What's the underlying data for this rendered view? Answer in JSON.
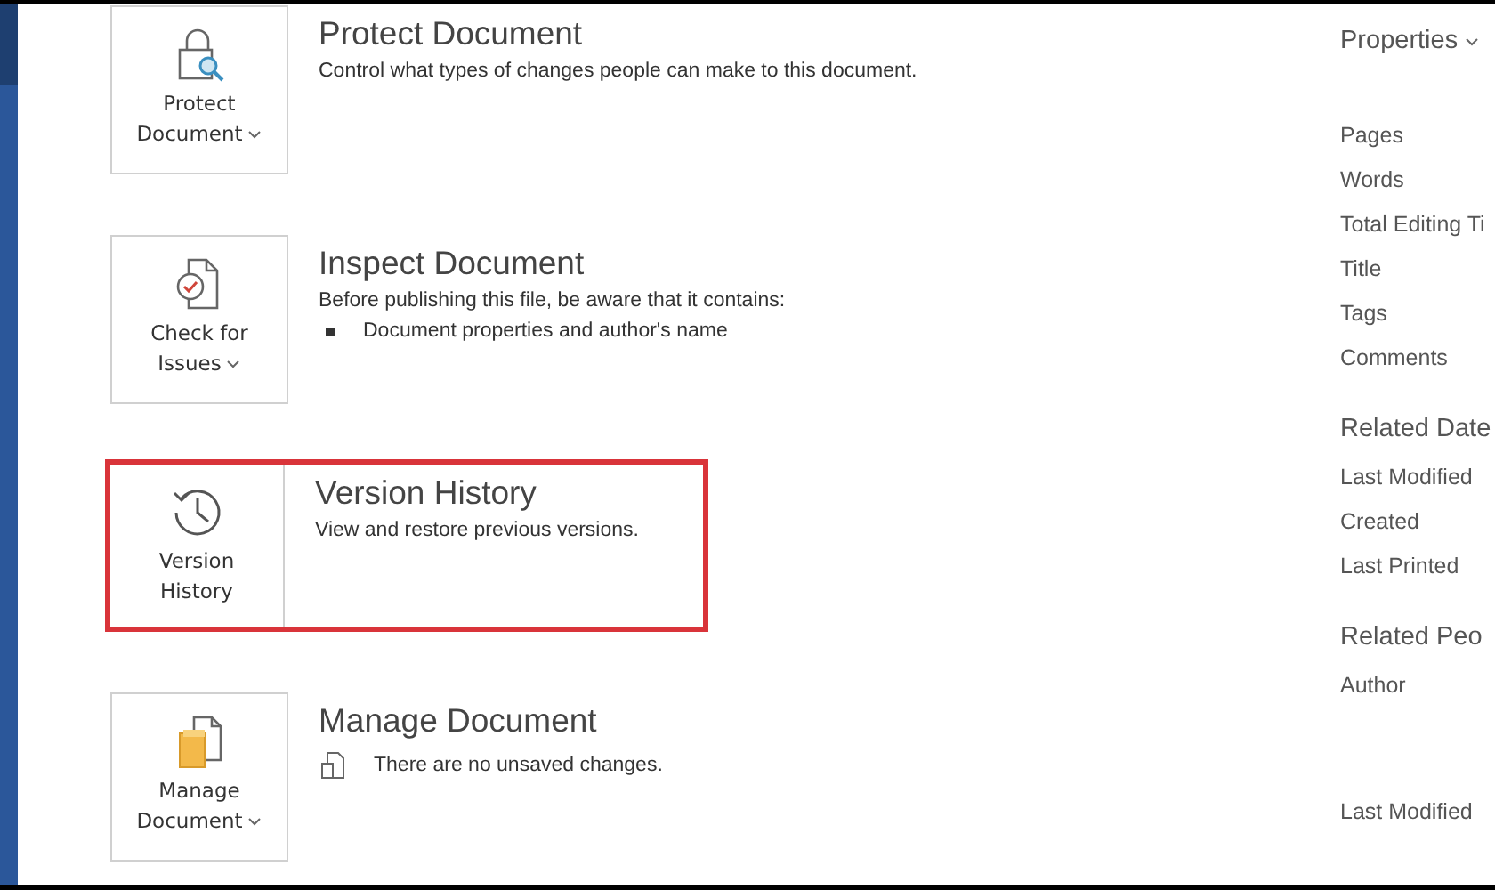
{
  "sections": [
    {
      "button_lines": [
        "Protect",
        "Document"
      ],
      "dropdown": true,
      "highlighted": false,
      "title": "Protect Document",
      "description": "Control what types of changes people can make to this document."
    },
    {
      "button_lines": [
        "Check for",
        "Issues"
      ],
      "dropdown": true,
      "highlighted": false,
      "title": "Inspect Document",
      "description": "Before publishing this file, be aware that it contains:",
      "details": [
        {
          "kind": "bullet",
          "text": "Document properties and author's name"
        }
      ]
    },
    {
      "button_lines": [
        "Version",
        "History"
      ],
      "dropdown": false,
      "highlighted": true,
      "title": "Version History",
      "description": "View and restore previous versions."
    },
    {
      "button_lines": [
        "Manage",
        "Document"
      ],
      "dropdown": true,
      "highlighted": false,
      "title": "Manage Document",
      "details": [
        {
          "kind": "note",
          "text": "There are no unsaved changes."
        }
      ]
    }
  ],
  "properties_panel": {
    "groups": [
      {
        "heading": "Properties",
        "dropdown": true,
        "items": [
          "Pages",
          "Words",
          "Total Editing Ti",
          "Title",
          "Tags",
          "Comments"
        ]
      },
      {
        "heading": "Related Date",
        "dropdown": false,
        "items": [
          "Last Modified",
          "Created",
          "Last Printed"
        ]
      },
      {
        "heading": "Related Peo",
        "dropdown": false,
        "items": [
          "Author"
        ]
      },
      {
        "items": [
          "Last Modified"
        ]
      }
    ]
  }
}
